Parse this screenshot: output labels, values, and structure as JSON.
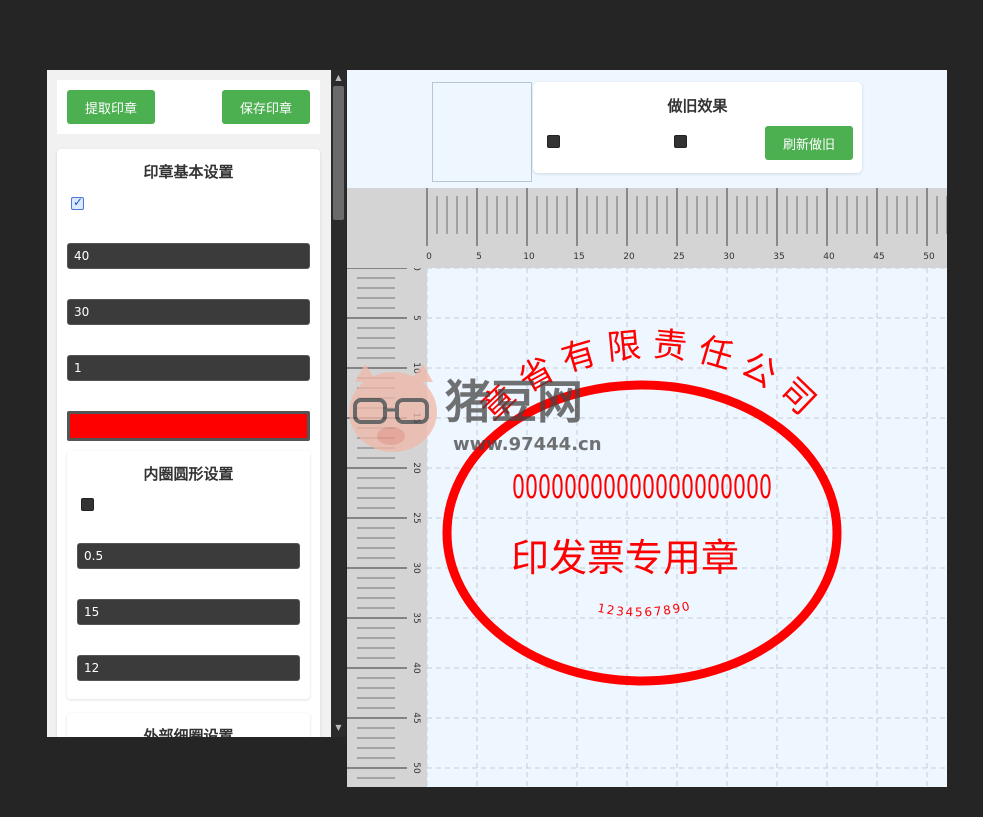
{
  "left_panel": {
    "extract_button": "提取印章",
    "save_button": "保存印章",
    "basic": {
      "title": "印章基本设置",
      "checkbox_checked": true,
      "width_value": "40",
      "height_value": "30",
      "border_value": "1",
      "color": "#ff0000"
    },
    "inner": {
      "title": "内圈圆形设置",
      "checkbox_checked": false,
      "line_value": "0.5",
      "width_value": "15",
      "height_value": "12"
    },
    "outer": {
      "title": "外部细圈设置"
    }
  },
  "old_effect": {
    "title": "做旧效果",
    "checkbox1_checked": false,
    "checkbox2_checked": false,
    "refresh_button": "刷新做旧"
  },
  "ruler": {
    "unit_labels": [
      "0",
      "5",
      "10",
      "15",
      "20",
      "25",
      "30",
      "35",
      "40",
      "45",
      "50"
    ]
  },
  "stamp": {
    "color": "#ff0000",
    "company_text": "章省有限责任公司",
    "code_text": "00000000000000000000",
    "type_text": "印发票专用章",
    "serial_text": "1234567890"
  },
  "watermark": {
    "brand": "猪豆网",
    "url": "www.97444.cn"
  }
}
